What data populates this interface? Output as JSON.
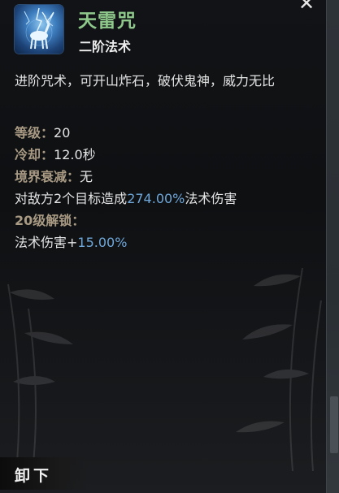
{
  "skill": {
    "name": "天雷咒",
    "tier": "二阶法术",
    "description": "进阶咒术，可开山炸石，破伏鬼神，威力无比"
  },
  "stats": {
    "level_label": "等级：",
    "level_value": "20",
    "cooldown_label": "冷却：",
    "cooldown_value": "12.0秒",
    "realm_decay_label": "境界衰减：",
    "realm_decay_value": "无",
    "effect_prefix": "对敌方2个目标造成",
    "effect_value": "274.00%",
    "effect_suffix": "法术伤害",
    "unlock_label": "20级解锁：",
    "unlock_prefix": "法术伤害+",
    "unlock_value": "15.00%"
  },
  "actions": {
    "close_symbol": "✕",
    "unload_label": "卸下"
  },
  "colors": {
    "title": "#8fc88b",
    "label": "#a99a84",
    "highlight": "#6fa7d9"
  },
  "icons": {
    "skill_icon": "thunder-deer-icon",
    "close_icon": "close-icon"
  }
}
